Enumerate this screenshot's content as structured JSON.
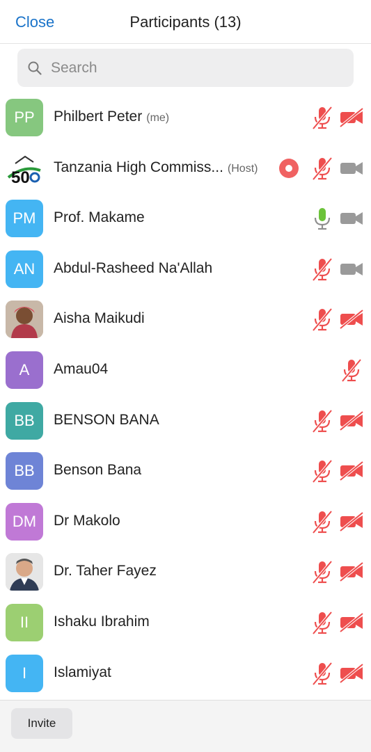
{
  "header": {
    "close_label": "Close",
    "title": "Participants (13)"
  },
  "search": {
    "placeholder": "Search",
    "icon": "search-icon"
  },
  "colors": {
    "accent": "#1a73c9",
    "muted_red": "#ee4e4e",
    "mic_on_green": "#6cc33a",
    "cam_on_gray": "#9a9a9a"
  },
  "participants": [
    {
      "name": "Philbert Peter",
      "tag": "(me)",
      "initials": "PP",
      "avatar_color": "#86c77f",
      "recording": false,
      "mic": "muted",
      "camera": "off"
    },
    {
      "name": "Tanzania High Commiss...",
      "tag": "(Host)",
      "initials": "",
      "avatar_color": "#ffffff",
      "recording": true,
      "mic": "muted",
      "camera": "on"
    },
    {
      "name": "Prof. Makame",
      "tag": "",
      "initials": "PM",
      "avatar_color": "#44b5f3",
      "recording": false,
      "mic": "on",
      "camera": "on"
    },
    {
      "name": "Abdul-Rasheed Na'Allah",
      "tag": "",
      "initials": "AN",
      "avatar_color": "#44b5f3",
      "recording": false,
      "mic": "muted",
      "camera": "on"
    },
    {
      "name": "Aisha Maikudi",
      "tag": "",
      "initials": "",
      "avatar_color": "#c9a98f",
      "recording": false,
      "mic": "muted",
      "camera": "off"
    },
    {
      "name": "Amau04",
      "tag": "",
      "initials": "A",
      "avatar_color": "#9a6fce",
      "recording": false,
      "mic": "muted",
      "camera": "none"
    },
    {
      "name": "BENSON BANA",
      "tag": "",
      "initials": "BB",
      "avatar_color": "#3fa9a3",
      "recording": false,
      "mic": "muted",
      "camera": "off"
    },
    {
      "name": "Benson Bana",
      "tag": "",
      "initials": "BB",
      "avatar_color": "#6e84d6",
      "recording": false,
      "mic": "muted",
      "camera": "off"
    },
    {
      "name": "Dr Makolo",
      "tag": "",
      "initials": "DM",
      "avatar_color": "#c079d6",
      "recording": false,
      "mic": "muted",
      "camera": "off"
    },
    {
      "name": "Dr. Taher Fayez",
      "tag": "",
      "initials": "",
      "avatar_color": "#d9d9d9",
      "recording": false,
      "mic": "muted",
      "camera": "off"
    },
    {
      "name": "Ishaku Ibrahim",
      "tag": "",
      "initials": "II",
      "avatar_color": "#9ccf72",
      "recording": false,
      "mic": "muted",
      "camera": "off"
    },
    {
      "name": "Islamiyat",
      "tag": "",
      "initials": "I",
      "avatar_color": "#44b5f3",
      "recording": false,
      "mic": "muted",
      "camera": "off"
    }
  ],
  "footer": {
    "invite_label": "Invite"
  }
}
